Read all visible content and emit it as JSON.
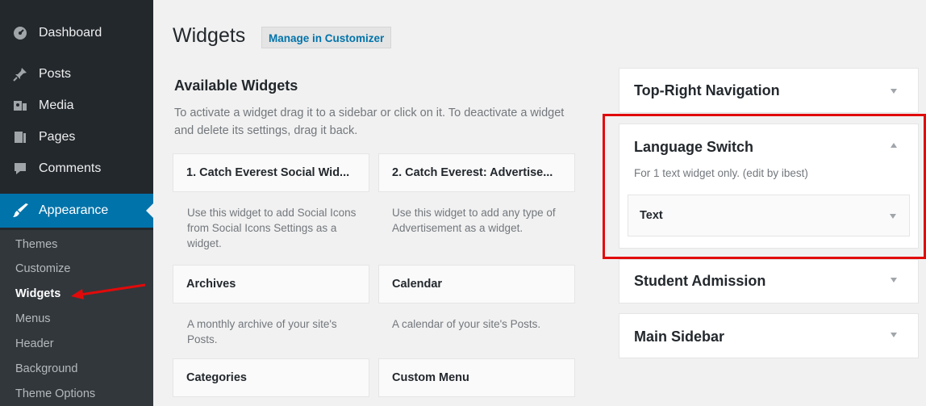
{
  "sidebar": {
    "items": [
      {
        "label": "Dashboard",
        "icon": "dashboard-icon"
      },
      {
        "label": "Posts",
        "icon": "pin-icon"
      },
      {
        "label": "Media",
        "icon": "media-icon"
      },
      {
        "label": "Pages",
        "icon": "pages-icon"
      },
      {
        "label": "Comments",
        "icon": "comment-icon"
      },
      {
        "label": "Appearance",
        "icon": "brush-icon"
      }
    ],
    "submenu": [
      "Themes",
      "Customize",
      "Widgets",
      "Menus",
      "Header",
      "Background",
      "Theme Options"
    ],
    "active_sub": "Widgets"
  },
  "header": {
    "title": "Widgets",
    "customizer_label": "Manage in Customizer"
  },
  "available": {
    "title": "Available Widgets",
    "description": "To activate a widget drag it to a sidebar or click on it. To deactivate a widget and delete its settings, drag it back.",
    "widgets": [
      {
        "title": "1. Catch Everest Social Wid...",
        "desc": "Use this widget to add Social Icons from Social Icons Settings as a widget."
      },
      {
        "title": "2. Catch Everest: Advertise...",
        "desc": "Use this widget to add any type of Advertisement as a widget."
      },
      {
        "title": "Archives",
        "desc": "A monthly archive of your site's Posts."
      },
      {
        "title": "Calendar",
        "desc": "A calendar of your site's Posts."
      },
      {
        "title": "Categories",
        "desc": ""
      },
      {
        "title": "Custom Menu",
        "desc": ""
      }
    ]
  },
  "sidebars": [
    {
      "title": "Top-Right Navigation",
      "expanded": false
    },
    {
      "title": "Language Switch",
      "expanded": true,
      "description": "For 1 text widget only. (edit by ibest)",
      "widgets": [
        "Text"
      ]
    },
    {
      "title": "Student Admission",
      "expanded": false
    },
    {
      "title": "Main Sidebar",
      "expanded": false
    }
  ],
  "colors": {
    "admin_bg": "#23282d",
    "submenu_bg": "#32373c",
    "accent": "#0073aa",
    "highlight": "#e10a0a"
  }
}
